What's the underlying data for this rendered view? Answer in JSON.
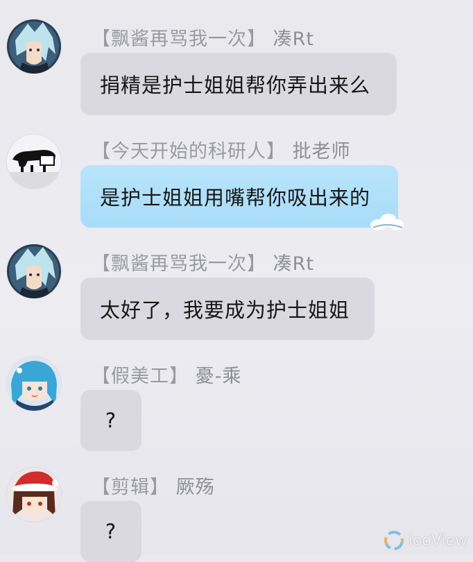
{
  "messages": [
    {
      "sender_title": "【飘酱再骂我一次】",
      "sender_name": "凑Rt",
      "text": "捐精是护士姐姐帮你弄出来么",
      "avatar_icon": "anime-character-avatar-icon",
      "bubble_style": "gray"
    },
    {
      "sender_title": "【今天开始的科研人】",
      "sender_name": "批老师",
      "text": "是护士姐姐用嘴帮你吸出来的",
      "avatar_icon": "black-animal-avatar-icon",
      "bubble_style": "blue"
    },
    {
      "sender_title": "【飘酱再骂我一次】",
      "sender_name": "凑Rt",
      "text": "太好了，我要成为护士姐姐",
      "avatar_icon": "anime-character-avatar-icon",
      "bubble_style": "gray"
    },
    {
      "sender_title": "【假美工】",
      "sender_name": "憂-乘",
      "text": "?",
      "avatar_icon": "blue-hair-anime-avatar-icon",
      "bubble_style": "gray"
    },
    {
      "sender_title": "【剪辑】",
      "sender_name": "厥殇",
      "text": "?",
      "avatar_icon": "santa-hat-anime-avatar-icon",
      "bubble_style": "gray"
    }
  ],
  "watermark": {
    "text": "iooView",
    "icon": "play-logo-icon"
  },
  "colors": {
    "background": "#ebebf0",
    "gray_bubble": "#d9d9df",
    "blue_bubble": "#b3e1fa",
    "sender_text": "#8e8e96",
    "message_text": "#161616"
  }
}
